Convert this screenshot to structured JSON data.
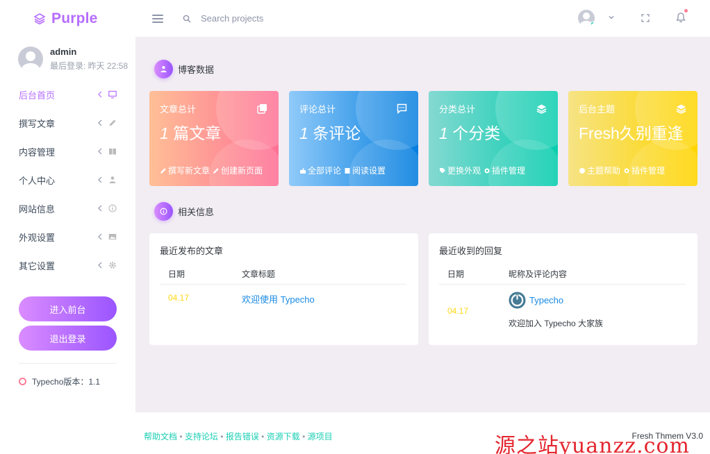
{
  "brand": {
    "name": "Purple"
  },
  "search": {
    "placeholder": "Search projects"
  },
  "profile": {
    "name": "admin",
    "last_login": "最后登录: 昨天 22:58"
  },
  "sidebar": {
    "items": [
      {
        "label": "后台首页",
        "icon": "monitor-icon"
      },
      {
        "label": "撰写文章",
        "icon": "pencil-icon"
      },
      {
        "label": "内容管理",
        "icon": "book-icon"
      },
      {
        "label": "个人中心",
        "icon": "user-icon"
      },
      {
        "label": "网站信息",
        "icon": "info-icon"
      },
      {
        "label": "外观设置",
        "icon": "image-icon"
      },
      {
        "label": "其它设置",
        "icon": "gear-icon"
      }
    ],
    "btn_front": "进入前台",
    "btn_logout": "退出登录",
    "version": "Typecho版本：1.1"
  },
  "section1": {
    "title": "博客数据"
  },
  "cards": [
    {
      "label": "文章总计",
      "num": "1",
      "unit": "篇文章",
      "links": [
        "撰写新文章",
        "创建新页面"
      ]
    },
    {
      "label": "评论总计",
      "num": "1",
      "unit": "条评论",
      "links": [
        "全部评论",
        "阅读设置"
      ]
    },
    {
      "label": "分类总计",
      "num": "1",
      "unit": "个分类",
      "links": [
        "更换外观",
        "插件管理"
      ]
    },
    {
      "label": "后台主题",
      "num": "",
      "unit": "Fresh久别重逢",
      "links": [
        "主题帮助",
        "插件管理"
      ]
    }
  ],
  "section2": {
    "title": "相关信息"
  },
  "posts": {
    "title": "最近发布的文章",
    "col_date": "日期",
    "col_title": "文章标题",
    "rows": [
      {
        "date": "04.17",
        "title": "欢迎使用 Typecho"
      }
    ]
  },
  "replies": {
    "title": "最近收到的回复",
    "col_date": "日期",
    "col_content": "昵称及评论内容",
    "rows": [
      {
        "date": "04.17",
        "author": "Typecho",
        "content": "欢迎加入 Typecho 大家族"
      }
    ]
  },
  "footer": {
    "links": [
      "帮助文档",
      "支持论坛",
      "报告错误",
      "资源下载",
      "源项目"
    ],
    "sep": "•",
    "right": "Fresh Thmem V3.0"
  },
  "watermark": "源之站yuanzz.com",
  "colors": {
    "accent": "#b66dff",
    "date": "#fed713",
    "link": "#198ae3",
    "footer_link": "#1bcfb4"
  }
}
